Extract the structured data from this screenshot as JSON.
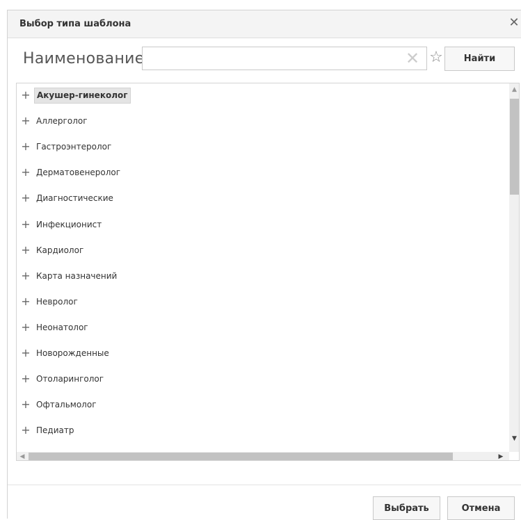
{
  "dialog": {
    "title": "Выбор типа шаблона",
    "close_icon": "close-icon"
  },
  "search": {
    "label": "Наименование",
    "value": "",
    "placeholder": "",
    "clear_icon": "clear-icon",
    "favorite_icon": "star-icon",
    "find_label": "Найти"
  },
  "tree": {
    "items": [
      {
        "label": "Акушер-гинеколог",
        "selected": true
      },
      {
        "label": "Аллерголог"
      },
      {
        "label": "Гастроэнтеролог"
      },
      {
        "label": "Дерматовенеролог"
      },
      {
        "label": "Диагностические"
      },
      {
        "label": "Инфекционист"
      },
      {
        "label": "Кардиолог"
      },
      {
        "label": "Карта назначений"
      },
      {
        "label": "Невролог"
      },
      {
        "label": "Неонатолог"
      },
      {
        "label": "Новорожденные"
      },
      {
        "label": "Отоларинголог"
      },
      {
        "label": "Офтальмолог"
      },
      {
        "label": "Педиатр"
      }
    ],
    "expand_icon": "plus-icon"
  },
  "footer": {
    "select_label": "Выбрать",
    "cancel_label": "Отмена"
  }
}
